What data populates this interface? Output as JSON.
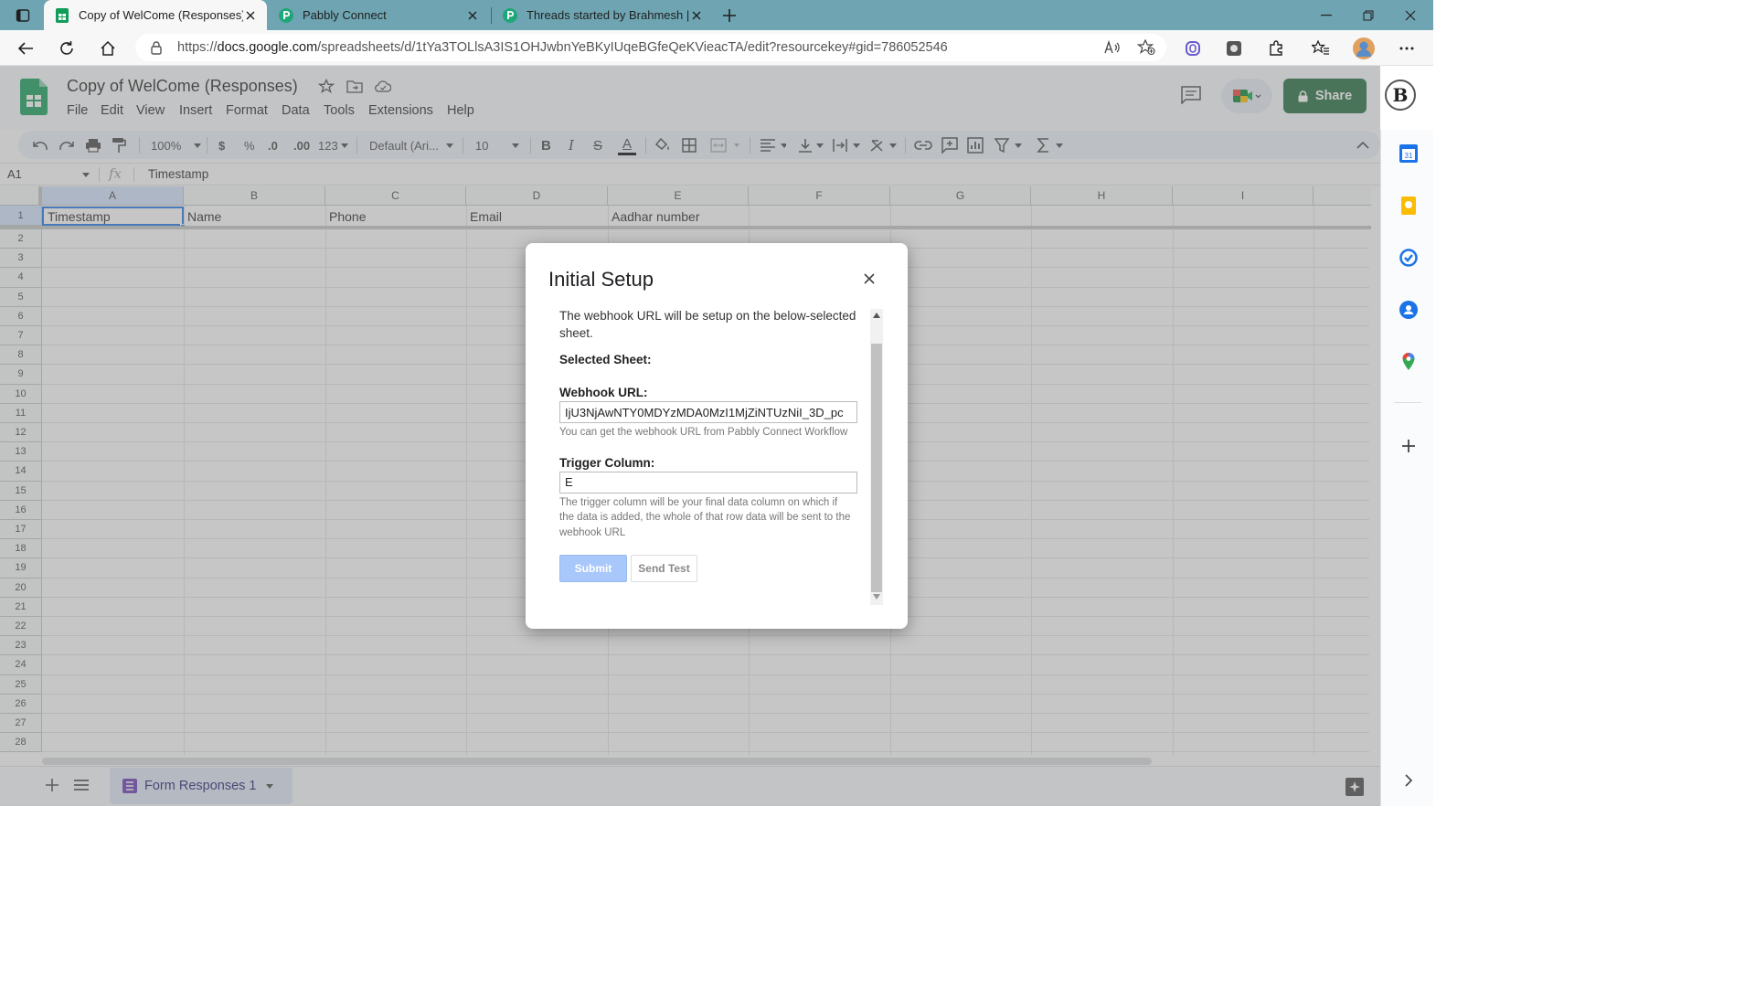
{
  "browser": {
    "tabs": [
      {
        "title": "Copy of WelCome (Responses) -"
      },
      {
        "title": "Pabbly Connect"
      },
      {
        "title": "Threads started by Brahmesh | P"
      }
    ],
    "url_prefix": "https://",
    "url_host": "docs.google.com",
    "url_path": "/spreadsheets/d/1tYa3TOLlsA3IS1OHJwbnYeBKyIUqeBGfeQeKVieacTA/edit?resourcekey#gid=786052546"
  },
  "sheets": {
    "title": "Copy of WelCome (Responses)",
    "menus": [
      "File",
      "Edit",
      "View",
      "Insert",
      "Format",
      "Data",
      "Tools",
      "Extensions",
      "Help"
    ],
    "share_label": "Share",
    "account_initial": "B",
    "toolbar": {
      "zoom": "100%",
      "currency": "$",
      "percent": "%",
      "dec_decrease": ".0",
      "dec_increase": ".00",
      "number_format": "123",
      "font": "Default (Ari...",
      "font_size": "10",
      "bold": "B",
      "italic": "I",
      "strike": "S",
      "textcolor": "A"
    },
    "name_box": "A1",
    "fx": "fx",
    "formula": "Timestamp",
    "columns": [
      "A",
      "B",
      "C",
      "D",
      "E",
      "F",
      "G",
      "H",
      "I"
    ],
    "header_row": [
      "Timestamp",
      "Name",
      "Phone",
      "Email",
      "Aadhar number"
    ],
    "rows": [
      "1",
      "2",
      "3",
      "4",
      "5",
      "6",
      "7",
      "8",
      "9",
      "10",
      "11",
      "12",
      "13",
      "14",
      "15",
      "16",
      "17",
      "18",
      "19",
      "20",
      "21",
      "22",
      "23",
      "24",
      "25",
      "26",
      "27",
      "28"
    ],
    "sheet_tab": "Form Responses 1"
  },
  "dialog": {
    "title": "Initial Setup",
    "intro": "The webhook URL will be setup on the below-selected sheet.",
    "selected_sheet_label": "Selected Sheet:",
    "webhook_label": "Webhook URL:",
    "webhook_value": "IjU3NjAwNTY0MDYzMDA0MzI1MjZiNTUzNiI_3D_pc",
    "webhook_help": "You can get the webhook URL from Pabbly Connect Workflow",
    "trigger_label": "Trigger Column:",
    "trigger_value": "E",
    "trigger_help": "The trigger column will be your final data column on which if the data is added, the whole of that row data will be sent to the webhook URL",
    "submit_label": "Submit",
    "send_test_label": "Send Test"
  },
  "colors": {
    "tabstrip": "#6fa5b2",
    "share": "#1e6b3a",
    "submit": "#a8c7fa",
    "sheets_green": "#0f9d58"
  }
}
